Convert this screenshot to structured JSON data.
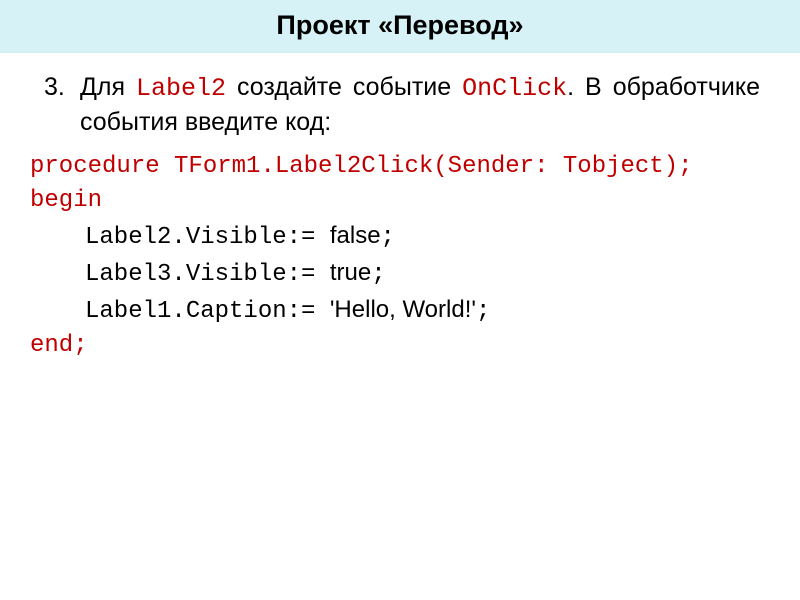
{
  "title": "Проект «Перевод»",
  "instruction": {
    "number": "3.",
    "part1": "Для ",
    "label2": "Label2",
    "part2": " создайте событие ",
    "onclick": "OnClick",
    "part3": ". В обработчике события введите код:"
  },
  "code": {
    "proc": "procedure TForm1.Label2Click(Sender: Tobject);",
    "begin": "begin",
    "l1a": "Label2.Visible:= ",
    "l1b": "false",
    "l1c": ";",
    "l2a": "Label3.Visible:= ",
    "l2b": "true",
    "l2c": ";",
    "l3a": "Label1.Caption:= ",
    "l3b": "'Hello, World!'",
    "l3c": ";",
    "end": "end;"
  }
}
